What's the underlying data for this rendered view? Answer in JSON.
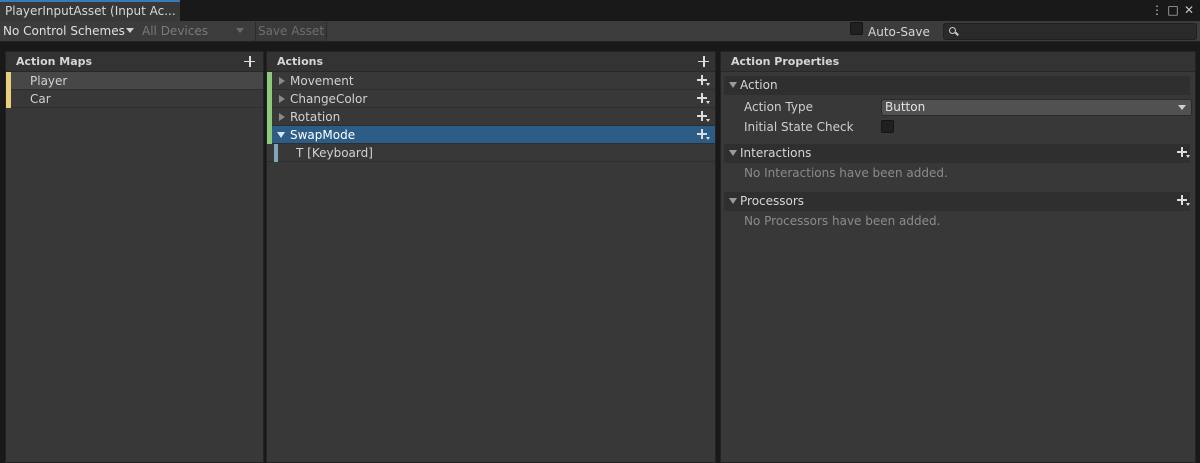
{
  "tab": {
    "title": "PlayerInputAsset (Input Ac..."
  },
  "window_controls": {
    "menu": "⋮",
    "maximize": "□",
    "close": "✕"
  },
  "toolbar": {
    "control_schemes": "No Control Schemes",
    "devices": "All Devices",
    "save_asset": "Save Asset",
    "auto_save_label": "Auto-Save",
    "auto_save_checked": false,
    "search_value": ""
  },
  "action_maps": {
    "header": "Action Maps",
    "stripe_color": "#e8d07a",
    "items": [
      {
        "label": "Player",
        "selected": true
      },
      {
        "label": "Car",
        "selected": false
      }
    ]
  },
  "actions": {
    "header": "Actions",
    "stripe_color": "#8fc97c",
    "binding_stripe_color": "#7fa7b7",
    "items": [
      {
        "label": "Movement",
        "expanded": false,
        "selected": false
      },
      {
        "label": "ChangeColor",
        "expanded": false,
        "selected": false
      },
      {
        "label": "Rotation",
        "expanded": false,
        "selected": false
      },
      {
        "label": "SwapMode",
        "expanded": true,
        "selected": true
      }
    ],
    "bindings": [
      {
        "label": "T [Keyboard]"
      }
    ]
  },
  "properties": {
    "header": "Action Properties",
    "action_section": "Action",
    "action_type_label": "Action Type",
    "action_type_value": "Button",
    "initial_state_label": "Initial State Check",
    "initial_state_checked": false,
    "interactions_section": "Interactions",
    "interactions_empty": "No Interactions have been added.",
    "processors_section": "Processors",
    "processors_empty": "No Processors have been added."
  },
  "colors": {
    "accent": "#3a79bb",
    "selection": "#2c5d87",
    "panel_bg": "#383838"
  }
}
